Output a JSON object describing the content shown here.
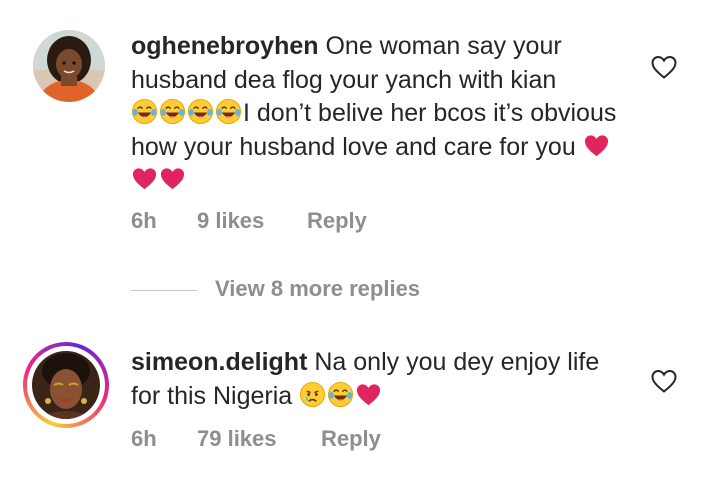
{
  "comments": [
    {
      "username": "oghenebroyhen",
      "text_part1": "One woman say your husband dea flog your yanch with kian",
      "text_part2": "I don’t belive her bcos it’s obvious how your husband love and care for you",
      "age": "6h",
      "likes": "9 likes",
      "reply_label": "Reply",
      "emojis_after_part1": [
        "tears-of-joy",
        "tears-of-joy",
        "tears-of-joy",
        "tears-of-joy"
      ],
      "emojis_after_part2": [
        "red-heart",
        "red-heart",
        "red-heart"
      ]
    },
    {
      "username": "simeon.delight",
      "text_part1": "Na only you dey enjoy life for this Nigeria",
      "age": "6h",
      "likes": "79 likes",
      "reply_label": "Reply",
      "emojis_after_part1": [
        "crying-face",
        "tears-of-joy",
        "red-heart"
      ]
    }
  ],
  "view_more_replies": "View 8 more replies",
  "icons": {
    "like": "heart-outline-icon",
    "avatar_ring_colors": [
      "#f9ce34",
      "#ee2a7b",
      "#6228d7"
    ]
  },
  "colors": {
    "text": "#262626",
    "meta": "#8e8e8e",
    "divider": "#c7c7c7",
    "heart_emoji": "#e0245e",
    "emoji_yellow": "#ffcc33"
  }
}
